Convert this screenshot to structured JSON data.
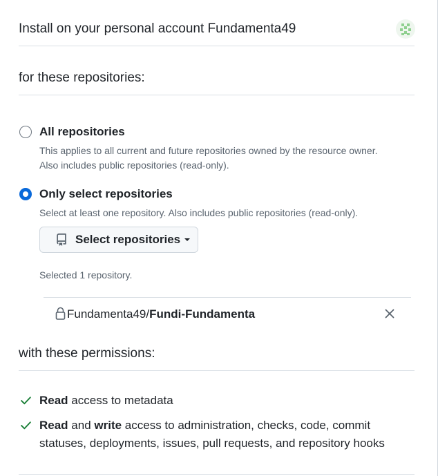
{
  "header": {
    "title": "Install on your personal account Fundamenta49"
  },
  "repositories_section": {
    "title": "for these repositories:",
    "options": [
      {
        "label": "All repositories",
        "selected": false,
        "description_line1": "This applies to all current and future repositories owned by the resource owner.",
        "description_line2": "Also includes public repositories (read-only)."
      },
      {
        "label": "Only select repositories",
        "selected": true,
        "description_line1": "Select at least one repository. Also includes public repositories (read-only)."
      }
    ],
    "select_button_label": "Select repositories",
    "selected_count_text": "Selected 1 repository.",
    "selected_repos": [
      {
        "owner": "Fundamenta49/",
        "name": "Fundi-Fundamenta"
      }
    ]
  },
  "permissions_section": {
    "title": "with these permissions:",
    "items": [
      {
        "bold1": "Read",
        "text1": " access to metadata"
      },
      {
        "bold1": "Read",
        "text1": " and ",
        "bold2": "write",
        "text2": " access to administration, checks, code, commit",
        "text3": "statuses, deployments, issues, pull requests, and repository hooks"
      }
    ]
  },
  "colors": {
    "accent": "#0969da",
    "success": "#1a7f37",
    "muted_text": "#59636e",
    "border": "#d0d7de"
  },
  "icons": {
    "avatar": "identicon-avatar",
    "repo": "repo-icon",
    "caret": "caret-down-icon",
    "lock": "lock-icon",
    "remove": "x-icon",
    "check": "check-icon"
  }
}
